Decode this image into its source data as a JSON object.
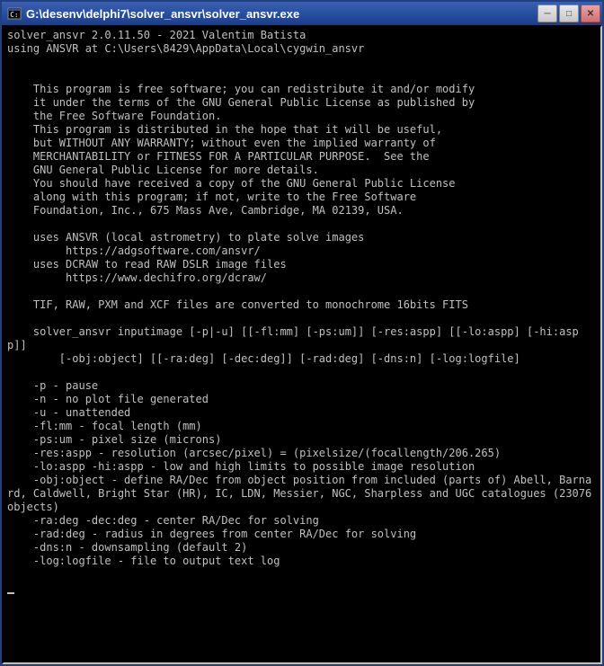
{
  "window": {
    "title": "G:\\desenv\\delphi7\\solver_ansvr\\solver_ansvr.exe"
  },
  "icons": {
    "app": "⊞",
    "minimize": "─",
    "maximize": "□",
    "close": "✕"
  },
  "console": {
    "lines": [
      "solver_ansvr 2.0.11.50 - 2021 Valentim Batista",
      "using ANSVR at C:\\Users\\8429\\AppData\\Local\\cygwin_ansvr",
      "",
      "",
      "    This program is free software; you can redistribute it and/or modify",
      "    it under the terms of the GNU General Public License as published by",
      "    the Free Software Foundation.",
      "    This program is distributed in the hope that it will be useful,",
      "    but WITHOUT ANY WARRANTY; without even the implied warranty of",
      "    MERCHANTABILITY or FITNESS FOR A PARTICULAR PURPOSE.  See the",
      "    GNU General Public License for more details.",
      "    You should have received a copy of the GNU General Public License",
      "    along with this program; if not, write to the Free Software",
      "    Foundation, Inc., 675 Mass Ave, Cambridge, MA 02139, USA.",
      "",
      "    uses ANSVR (local astrometry) to plate solve images",
      "         https://adgsoftware.com/ansvr/",
      "    uses DCRAW to read RAW DSLR image files",
      "         https://www.dechifro.org/dcraw/",
      "",
      "    TIF, RAW, PXM and XCF files are converted to monochrome 16bits FITS",
      "",
      "    solver_ansvr inputimage [-p|-u] [[-fl:mm] [-ps:um]] [-res:aspp] [[-lo:aspp] [-hi:aspp]]",
      "        [-obj:object] [[-ra:deg] [-dec:deg]] [-rad:deg] [-dns:n] [-log:logfile]",
      "",
      "    -p - pause",
      "    -n - no plot file generated",
      "    -u - unattended",
      "    -fl:mm - focal length (mm)",
      "    -ps:um - pixel size (microns)",
      "    -res:aspp - resolution (arcsec/pixel) = (pixelsize/(focallength/206.265)",
      "    -lo:aspp -hi:aspp - low and high limits to possible image resolution",
      "    -obj:object - define RA/Dec from object position from included (parts of) Abell, Barnard, Caldwell, Bright Star (HR), IC, LDN, Messier, NGC, Sharpless and UGC catalogues (23076 objects)",
      "    -ra:deg -dec:deg - center RA/Dec for solving",
      "    -rad:deg - radius in degrees from center RA/Dec for solving",
      "    -dns:n - downsampling (default 2)",
      "    -log:logfile - file to output text log",
      ""
    ]
  }
}
